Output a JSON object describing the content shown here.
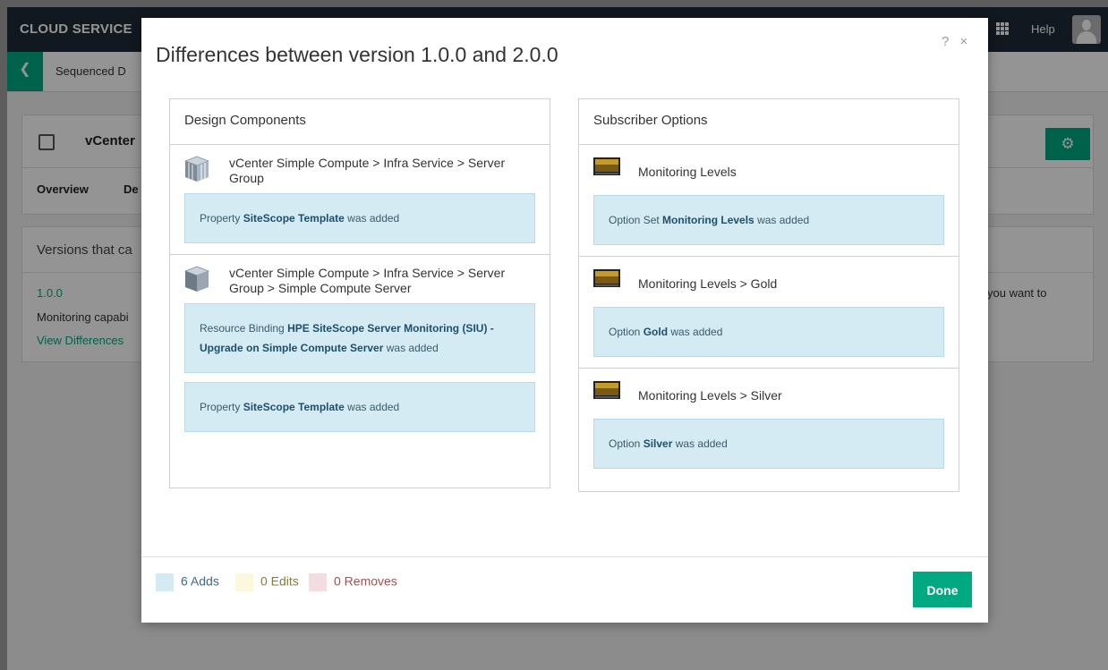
{
  "app": {
    "brand": "CLOUD SERVICE",
    "help_label": "Help",
    "breadcrumb": "Sequenced D",
    "card_title": "vCenter",
    "tabs": [
      "Overview",
      "De"
    ],
    "versions_title": "Versions that ca",
    "version_number": "1.0.0",
    "version_desc": "Monitoring capabi",
    "view_differences": "View Differences",
    "version_right_text": "you want to"
  },
  "modal": {
    "title": "Differences between version 1.0.0 and 2.0.0",
    "help_glyph": "?",
    "close_glyph": "×",
    "design_components": {
      "header": "Design Components",
      "items": [
        {
          "path": "vCenter Simple Compute > Infra Service > Server Group",
          "changes": [
            {
              "prefix": "Property ",
              "name": "SiteScope Template",
              "suffix": " was added"
            }
          ]
        },
        {
          "path": "vCenter Simple Compute > Infra Service > Server Group > Simple Compute Server",
          "changes": [
            {
              "prefix": "Resource Binding ",
              "name": "HPE SiteScope Server Monitoring (SIU) - Upgrade on Simple Compute Server",
              "suffix": " was added"
            },
            {
              "prefix": "Property ",
              "name": "SiteScope Template",
              "suffix": " was added"
            }
          ]
        }
      ]
    },
    "subscriber_options": {
      "header": "Subscriber Options",
      "items": [
        {
          "path": "Monitoring Levels",
          "changes": [
            {
              "prefix": "Option Set ",
              "name": "Monitoring Levels",
              "suffix": " was added"
            }
          ]
        },
        {
          "path": "Monitoring Levels > Gold",
          "changes": [
            {
              "prefix": "Option ",
              "name": "Gold",
              "suffix": " was added"
            }
          ]
        },
        {
          "path": "Monitoring Levels > Silver",
          "changes": [
            {
              "prefix": "Option ",
              "name": "Silver",
              "suffix": " was added"
            }
          ]
        }
      ]
    },
    "legend": {
      "adds": "6 Adds",
      "edits": "0 Edits",
      "removes": "0 Removes"
    },
    "done_label": "Done"
  },
  "colors": {
    "accent": "#01a982",
    "add_fill": "#d4ebf4",
    "edit_fill": "#fdf7dc",
    "remove_fill": "#f4dde0",
    "adds_text": "#3a6b8a",
    "edits_text": "#8a7a3a",
    "removes_text": "#a0524f"
  },
  "icons": {
    "component": "server-cube-icon",
    "subscriber_option": "monitor-icon"
  }
}
